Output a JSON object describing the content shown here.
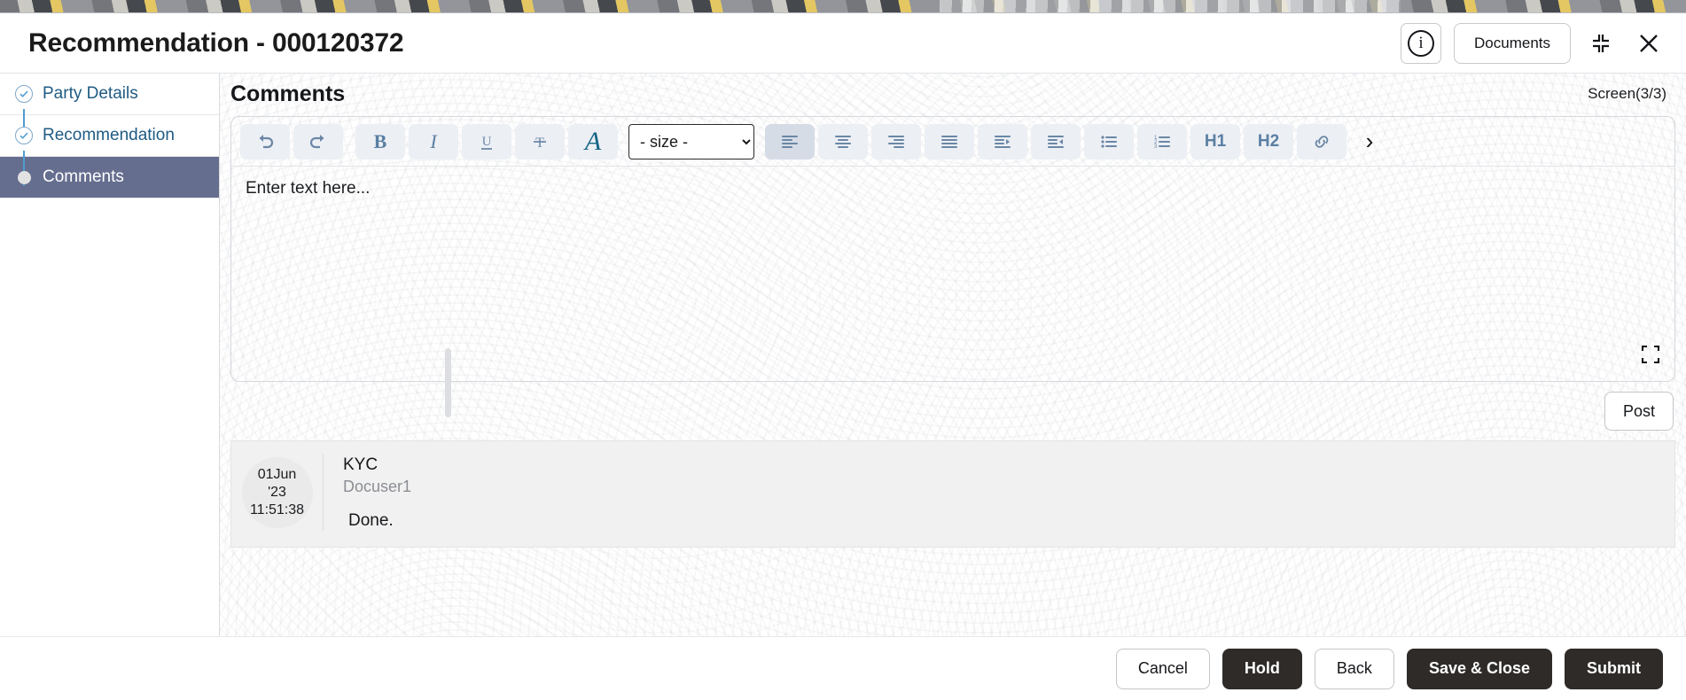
{
  "header": {
    "title": "Recommendation - 000120372",
    "info_icon": "info-circle-icon",
    "documents_label": "Documents",
    "collapse_icon": "collapse-icon",
    "close_icon": "close-icon"
  },
  "sidebar": {
    "items": [
      {
        "label": "Party Details",
        "state": "done",
        "marker": "check-circle-icon"
      },
      {
        "label": "Recommendation",
        "state": "done",
        "marker": "check-circle-icon"
      },
      {
        "label": "Comments",
        "state": "active",
        "marker": "dot-marker-icon"
      }
    ]
  },
  "main": {
    "pane_title": "Comments",
    "screen_count": "Screen(3/3)"
  },
  "editor": {
    "placeholder": "Enter text here...",
    "size_select": {
      "value": "- size -",
      "options": [
        "- size -"
      ]
    },
    "expand_icon": "expand-icon",
    "toolbar": [
      {
        "name": "undo-icon",
        "label": "",
        "kind": "icon"
      },
      {
        "name": "redo-icon",
        "label": "",
        "kind": "icon"
      },
      {
        "name": "bold-icon",
        "label": "B",
        "kind": "text"
      },
      {
        "name": "italic-icon",
        "label": "I",
        "kind": "italic"
      },
      {
        "name": "underline-icon",
        "label": "U",
        "kind": "underline"
      },
      {
        "name": "strikethrough-icon",
        "label": "T",
        "kind": "strike"
      },
      {
        "name": "font-color-icon",
        "label": "A",
        "kind": "fontcolor"
      },
      {
        "name": "align-left-icon",
        "label": "",
        "kind": "icon"
      },
      {
        "name": "align-center-icon",
        "label": "",
        "kind": "icon"
      },
      {
        "name": "align-right-icon",
        "label": "",
        "kind": "icon"
      },
      {
        "name": "align-justify-icon",
        "label": "",
        "kind": "icon"
      },
      {
        "name": "indent-icon",
        "label": "",
        "kind": "icon"
      },
      {
        "name": "outdent-icon",
        "label": "",
        "kind": "icon"
      },
      {
        "name": "bullet-list-icon",
        "label": "",
        "kind": "icon"
      },
      {
        "name": "numbered-list-icon",
        "label": "",
        "kind": "icon"
      },
      {
        "name": "heading-1-icon",
        "label": "H1",
        "kind": "head"
      },
      {
        "name": "heading-2-icon",
        "label": "H2",
        "kind": "head"
      },
      {
        "name": "link-icon",
        "label": "",
        "kind": "icon"
      },
      {
        "name": "toolbar-more-icon",
        "label": "›",
        "kind": "chev"
      }
    ]
  },
  "post": {
    "label": "Post"
  },
  "comments": [
    {
      "date_line1": "01Jun",
      "date_line2": "'23",
      "date_line3": "11:51:38",
      "title": "KYC",
      "user": "Docuser1",
      "text": "Done."
    }
  ],
  "footer": {
    "buttons": [
      {
        "label": "Cancel",
        "style": "outline"
      },
      {
        "label": "Hold",
        "style": "solid"
      },
      {
        "label": "Back",
        "style": "outline"
      },
      {
        "label": "Save & Close",
        "style": "solid"
      },
      {
        "label": "Submit",
        "style": "solid"
      }
    ]
  },
  "colors": {
    "active_nav": "#666e8f",
    "nav_link": "#1f5b84",
    "solid_button": "#2e2b29",
    "toolbar_icon": "#6b87a6",
    "font_color_accent": "#146685"
  }
}
